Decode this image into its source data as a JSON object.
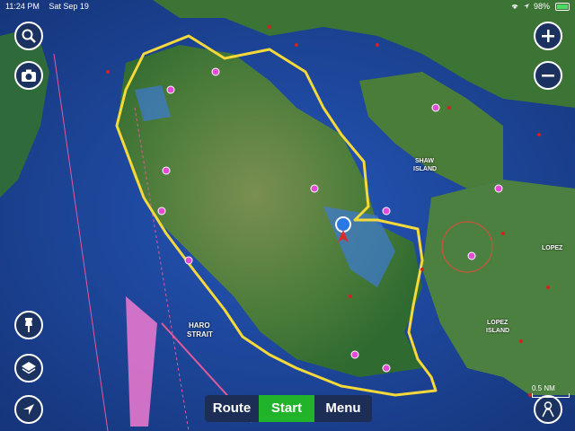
{
  "status_bar": {
    "time": "11:24 PM",
    "date": "Sat Sep 19",
    "battery_percent": "98%",
    "battery_level": 0.98,
    "icons": [
      "wifi-icon",
      "location-arrow-icon",
      "battery-icon"
    ]
  },
  "map_labels": {
    "haro_strait": "HARO",
    "haro_strait_2": "STRAIT",
    "shaw_island": "SHAW",
    "shaw_island_2": "ISLAND",
    "lopez_island": "LOPEZ",
    "lopez_island_2": "ISLAND",
    "lopez": "LOPEZ"
  },
  "left_controls": {
    "search_icon": "search-icon",
    "camera_icon": "camera-icon",
    "pin_icon": "pin-icon",
    "layers_icon": "layers-icon",
    "navigate_icon": "navigate-arrow-icon"
  },
  "right_controls": {
    "zoom_in_icon": "plus-icon",
    "zoom_out_icon": "minus-icon",
    "person_icon": "person-icon"
  },
  "bottom_bar": {
    "route_label": "Route",
    "start_label": "Start",
    "menu_label": "Menu"
  },
  "scale": {
    "label": "0.5 NM"
  },
  "colors": {
    "deep_water": "#1a3f8a",
    "shallow_water": "#3d7ad6",
    "land_green": "#3f7a35",
    "route_line": "#f5d83a",
    "start_button": "#21b32a",
    "toolbar_bg": "#1c2e55"
  }
}
